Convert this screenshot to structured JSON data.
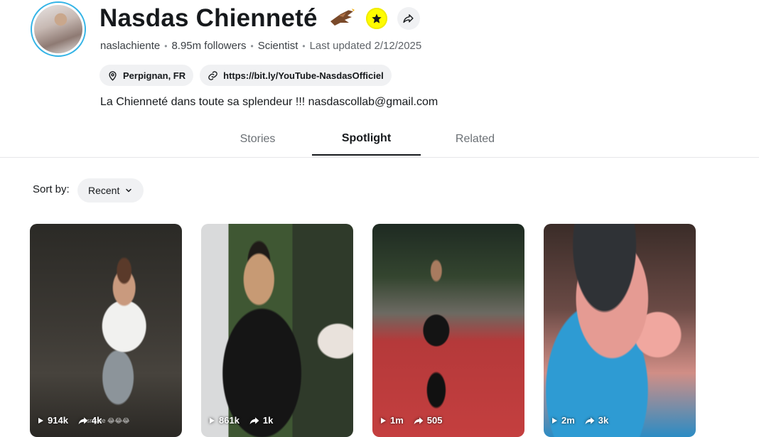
{
  "profile": {
    "name": "Nasdas Chienneté",
    "username": "naslachiente",
    "followers": "8.95m followers",
    "category": "Scientist",
    "last_updated": "Last updated 2/12/2025",
    "location": "Perpignan, FR",
    "link": "https://bit.ly/YouTube-NasdasOfficiel",
    "bio": "La Chienneté dans toute sa splendeur !!! nasdascollab@gmail.com",
    "badge_color": "#fffc00",
    "avatar_ring_color": "#34b4e6"
  },
  "tabs": [
    {
      "label": "Stories",
      "active": false
    },
    {
      "label": "Spotlight",
      "active": true
    },
    {
      "label": "Related",
      "active": false
    }
  ],
  "sort": {
    "label": "Sort by:",
    "value": "Recent"
  },
  "videos": [
    {
      "views": "914k",
      "shares": "4k",
      "caption": "sngale 😂😂😂"
    },
    {
      "views": "861k",
      "shares": "1k"
    },
    {
      "views": "1m",
      "shares": "505"
    },
    {
      "views": "2m",
      "shares": "3k"
    }
  ]
}
